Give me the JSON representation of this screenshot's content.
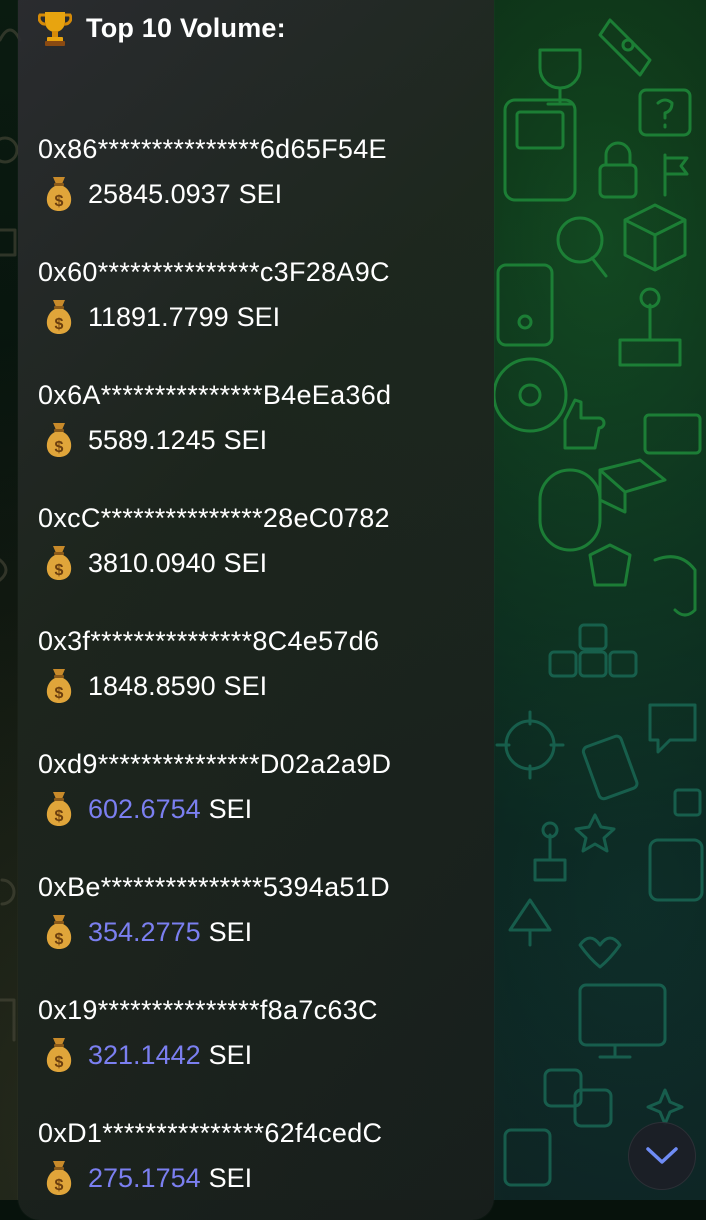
{
  "message": {
    "title": "Top 10 Volume:",
    "title_icon": "trophy-icon",
    "entries": [
      {
        "address": "0x86***************6d65F54E",
        "amount": "25845.0937",
        "unit": "SEI",
        "amount_link": false
      },
      {
        "address": "0x60***************c3F28A9C",
        "amount": "11891.7799",
        "unit": "SEI",
        "amount_link": false
      },
      {
        "address": "0x6A***************B4eEa36d",
        "amount": "5589.1245",
        "unit": "SEI",
        "amount_link": false
      },
      {
        "address": "0xcC***************28eC0782",
        "amount": "3810.0940",
        "unit": "SEI",
        "amount_link": false
      },
      {
        "address": "0x3f***************8C4e57d6",
        "amount": "1848.8590",
        "unit": "SEI",
        "amount_link": false
      },
      {
        "address": "0xd9***************D02a2a9D",
        "amount": "602.6754",
        "unit": "SEI",
        "amount_link": true
      },
      {
        "address": "0xBe***************5394a51D",
        "amount": "354.2775",
        "unit": "SEI",
        "amount_link": true
      },
      {
        "address": "0x19***************f8a7c63C",
        "amount": "321.1442",
        "unit": "SEI",
        "amount_link": true
      },
      {
        "address": "0xD1***************62f4cedC",
        "amount": "275.1754",
        "unit": "SEI",
        "amount_link": true
      }
    ],
    "entry_icon": "money-bag-icon"
  },
  "scroll_down": {
    "icon": "chevron-down-icon"
  },
  "colors": {
    "link": "#7b7ff0",
    "text": "#ffffff",
    "accent_doodle": "#1f7a34"
  }
}
